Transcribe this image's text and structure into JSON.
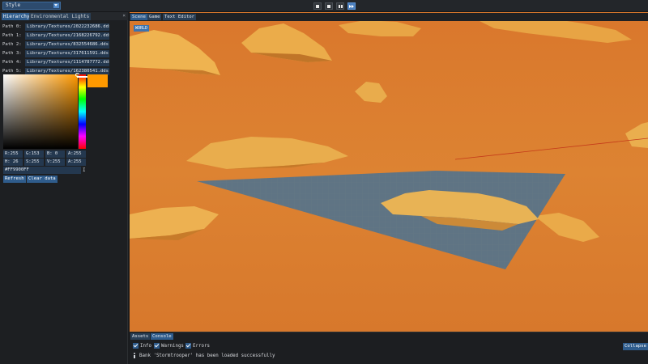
{
  "toolbar": {
    "style_label": "Style",
    "controls": [
      "stop",
      "step",
      "pause",
      "fast-forward"
    ]
  },
  "left_panel": {
    "tabs": [
      "Hierarchy",
      "Environmental Lights"
    ],
    "paths": [
      {
        "label": "Path 0:",
        "value": "Library/Textures/2022232686.dds"
      },
      {
        "label": "Path 1:",
        "value": "Library/Textures/2168226792.dds"
      },
      {
        "label": "Path 2:",
        "value": "Library/Textures/832554686.dds"
      },
      {
        "label": "Path 3:",
        "value": "Library/Textures/317611591.dds"
      },
      {
        "label": "Path 4:",
        "value": "Library/Textures/1114787772.dds"
      },
      {
        "label": "Path 5:",
        "value": "Library/Textures/162380541.dds"
      }
    ],
    "color": {
      "current_hex_color": "#ff9900",
      "R": "R:255",
      "G": "G:153",
      "B": "B:  0",
      "A1": "A:255",
      "H": "H: 26",
      "S": "S:255",
      "V": "V:255",
      "A2": "A:255",
      "hex_value": "#FF9900FF"
    },
    "buttons": {
      "refresh": "Refresh",
      "clear": "Clear data"
    }
  },
  "viewport": {
    "tabs": [
      "Scene",
      "Game",
      "Text Editor"
    ],
    "world_badge": "WORLD",
    "sky_color": "#d9772c",
    "grid_color": "#5f7484",
    "terrain_color": "#e8b355"
  },
  "console": {
    "tabs": [
      "Assets",
      "Console"
    ],
    "filters": [
      "Info",
      "Warnings",
      "Errors"
    ],
    "collapse_label": "Collapse",
    "log_message": "Bank 'Stormtrooper' has been loaded successfully"
  }
}
